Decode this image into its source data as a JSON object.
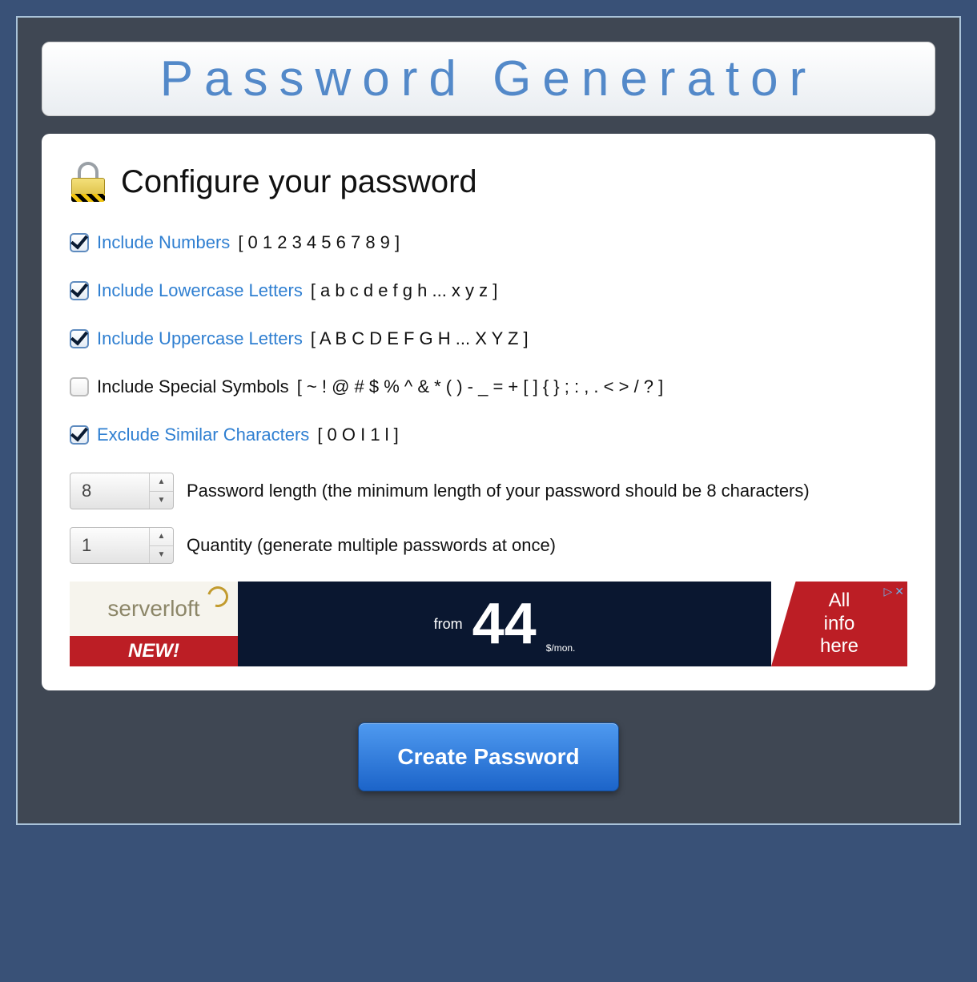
{
  "title": "Password Generator",
  "heading": "Configure your password",
  "options": [
    {
      "checked": true,
      "label": "Include Numbers",
      "highlighted": true,
      "hint": "[ 0 1 2 3 4 5 6 7 8 9 ]"
    },
    {
      "checked": true,
      "label": "Include Lowercase Letters",
      "highlighted": true,
      "hint": "[ a b c d e f g h ... x y z ]"
    },
    {
      "checked": true,
      "label": "Include Uppercase Letters",
      "highlighted": true,
      "hint": "[ A B C D E F G H ... X Y Z ]"
    },
    {
      "checked": false,
      "label": "Include Special Symbols",
      "highlighted": false,
      "hint": "[ ~ ! @ # $ % ^ & * ( ) - _ = + [ ] { } ; : , . < > / ? ]"
    },
    {
      "checked": true,
      "label": "Exclude Similar Characters",
      "highlighted": true,
      "hint": "[ 0 O I 1 l ]"
    }
  ],
  "length": {
    "value": "8",
    "label": "Password length (the minimum length of your password should be 8 characters)"
  },
  "quantity": {
    "value": "1",
    "label": "Quantity (generate multiple passwords at once)"
  },
  "ad": {
    "brand": "serverloft",
    "new_label": "NEW!",
    "from_label": "from",
    "price": "44",
    "unit": "$/mon.",
    "cta1": "All",
    "cta2": "info",
    "cta3": "here"
  },
  "submit_label": "Create Password"
}
